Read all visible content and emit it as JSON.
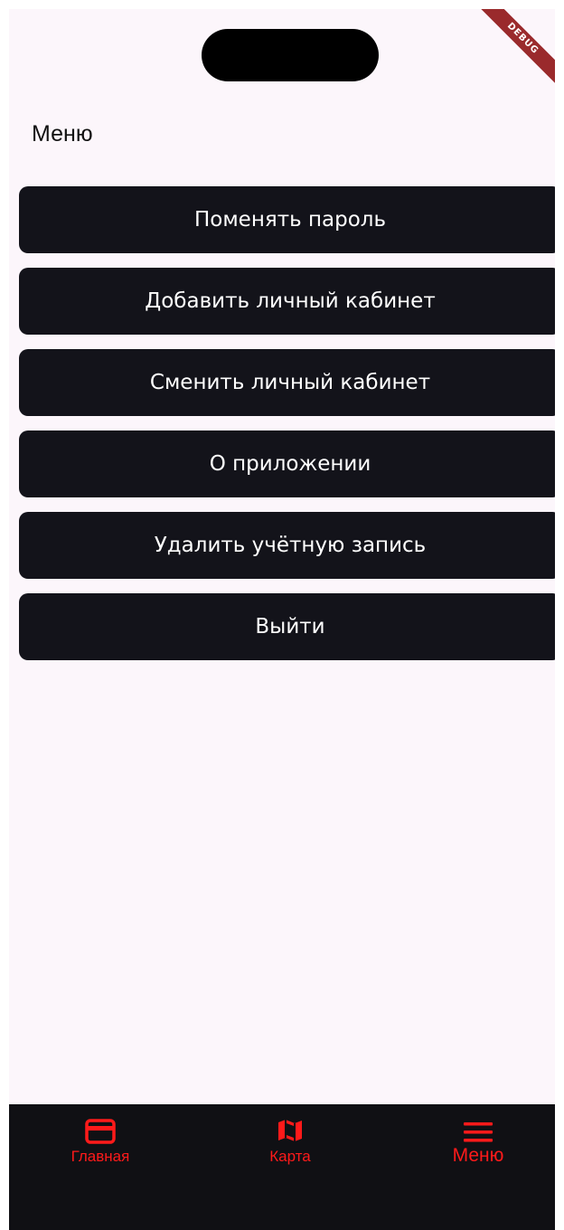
{
  "debug_banner": "DEBUG",
  "page_title": "Меню",
  "menu_buttons": [
    "Поменять пароль",
    "Добавить личный кабинет",
    "Сменить личный кабинет",
    "О приложении",
    "Удалить учётную запись",
    "Выйти"
  ],
  "bottom_nav": {
    "items": [
      {
        "label": "Главная",
        "icon": "card-icon"
      },
      {
        "label": "Карта",
        "icon": "map-icon"
      },
      {
        "label": "Меню",
        "icon": "hamburger-menu-icon"
      }
    ],
    "active_label": "Меню"
  },
  "colors": {
    "background": "#fcf6fb",
    "button": "#13131a",
    "button_text": "#ffffff",
    "nav_background": "#101014",
    "accent": "#ff1a1a"
  }
}
